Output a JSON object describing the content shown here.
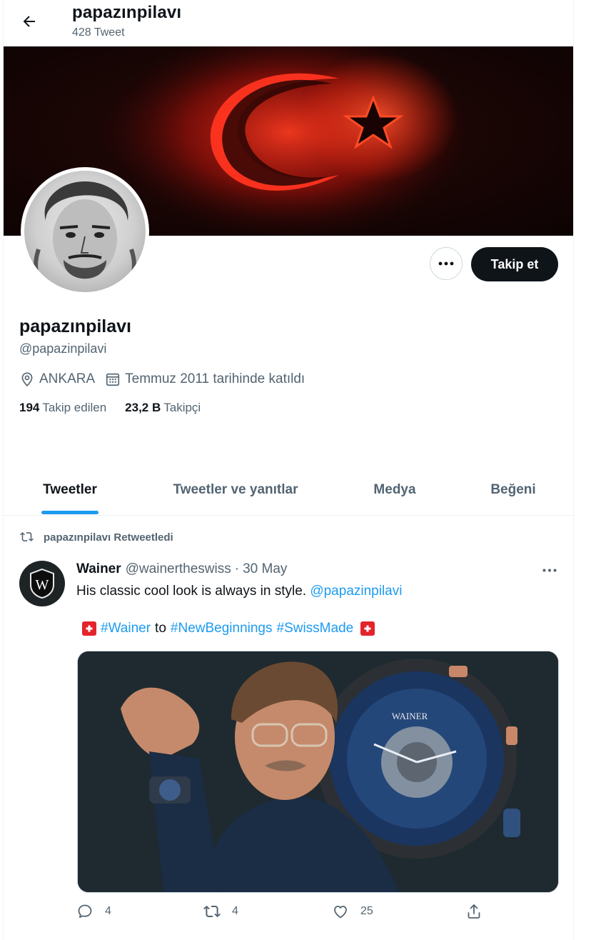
{
  "header": {
    "title": "papazınpilavı",
    "tweet_count": "428 Tweet"
  },
  "profile": {
    "display_name": "papazınpilavı",
    "handle": "@papazinpilavi",
    "location": "ANKARA",
    "joined": "Temmuz 2011 tarihinde katıldı",
    "following_count": "194",
    "following_label": "Takip edilen",
    "followers_count": "23,2 B",
    "followers_label": "Takipçi",
    "follow_label": "Takip et"
  },
  "tabs": [
    {
      "label": "Tweetler",
      "active": true
    },
    {
      "label": "Tweetler ve yanıtlar",
      "active": false
    },
    {
      "label": "Medya",
      "active": false
    },
    {
      "label": "Beğeni",
      "active": false
    }
  ],
  "tweet": {
    "retweet_notice": "papazınpilavı Retweetledi",
    "author_name": "Wainer",
    "author_handle": "@wainertheswiss",
    "separator": "·",
    "date": "30 May",
    "text_main": "His classic cool look is always in style.",
    "mention": "@papazinpilavi",
    "hashtag_1": "#Wainer",
    "word_to": "to",
    "hashtag_2": "#NewBeginnings",
    "hashtag_3": "#SwissMade",
    "reply_count": "4",
    "retweet_count": "4",
    "like_count": "25"
  },
  "colors": {
    "accent": "#1d9bf0",
    "text_primary": "#0f1419",
    "text_secondary": "#536471",
    "follow_button": "#0f1419",
    "banner_red": "#ff2a1a"
  }
}
